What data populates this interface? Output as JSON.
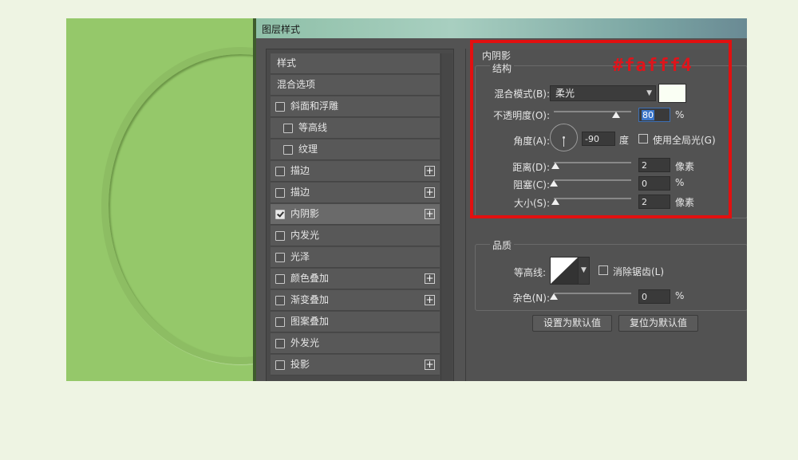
{
  "window": {
    "title": "图层样式"
  },
  "style_list": {
    "items": [
      {
        "label": "样式",
        "checkbox": false,
        "checked": false,
        "plus": false,
        "indent": false
      },
      {
        "label": "混合选项",
        "checkbox": false,
        "checked": false,
        "plus": false,
        "indent": false
      },
      {
        "label": "斜面和浮雕",
        "checkbox": true,
        "checked": false,
        "plus": false,
        "indent": false
      },
      {
        "label": "等高线",
        "checkbox": true,
        "checked": false,
        "plus": false,
        "indent": true
      },
      {
        "label": "纹理",
        "checkbox": true,
        "checked": false,
        "plus": false,
        "indent": true
      },
      {
        "label": "描边",
        "checkbox": true,
        "checked": false,
        "plus": true,
        "indent": false
      },
      {
        "label": "描边",
        "checkbox": true,
        "checked": false,
        "plus": true,
        "indent": false
      },
      {
        "label": "内阴影",
        "checkbox": true,
        "checked": true,
        "plus": true,
        "indent": false,
        "selected": true
      },
      {
        "label": "内发光",
        "checkbox": true,
        "checked": false,
        "plus": false,
        "indent": false
      },
      {
        "label": "光泽",
        "checkbox": true,
        "checked": false,
        "plus": false,
        "indent": false
      },
      {
        "label": "颜色叠加",
        "checkbox": true,
        "checked": false,
        "plus": true,
        "indent": false
      },
      {
        "label": "渐变叠加",
        "checkbox": true,
        "checked": false,
        "plus": true,
        "indent": false
      },
      {
        "label": "图案叠加",
        "checkbox": true,
        "checked": false,
        "plus": false,
        "indent": false
      },
      {
        "label": "外发光",
        "checkbox": true,
        "checked": false,
        "plus": false,
        "indent": false
      },
      {
        "label": "投影",
        "checkbox": true,
        "checked": false,
        "plus": true,
        "indent": false
      }
    ]
  },
  "inner_shadow": {
    "section_title": "内阴影",
    "structure_title": "结构",
    "blend_mode": {
      "label": "混合模式(B):",
      "value": "柔光",
      "color": "#fafff4"
    },
    "opacity": {
      "label": "不透明度(O):",
      "value": "80",
      "unit": "%",
      "level": 0.8
    },
    "angle": {
      "label": "角度(A):",
      "value": "-90",
      "unit": "度",
      "global_light_label": "使用全局光(G)"
    },
    "distance": {
      "label": "距离(D):",
      "value": "2",
      "unit": "像素",
      "level": 0.02
    },
    "choke": {
      "label": "阻塞(C):",
      "value": "0",
      "unit": "%",
      "level": 0.0
    },
    "size": {
      "label": "大小(S):",
      "value": "2",
      "unit": "像素",
      "level": 0.02
    }
  },
  "quality": {
    "title": "品质",
    "contour_label": "等高线:",
    "antialias_label": "消除锯齿(L)",
    "noise": {
      "label": "杂色(N):",
      "value": "0",
      "unit": "%",
      "level": 0.0
    }
  },
  "buttons": {
    "set_default": "设置为默认值",
    "reset_default": "复位为默认值"
  },
  "annotation": {
    "color_text": "#fafff4",
    "highlight_color": "#e21010"
  }
}
